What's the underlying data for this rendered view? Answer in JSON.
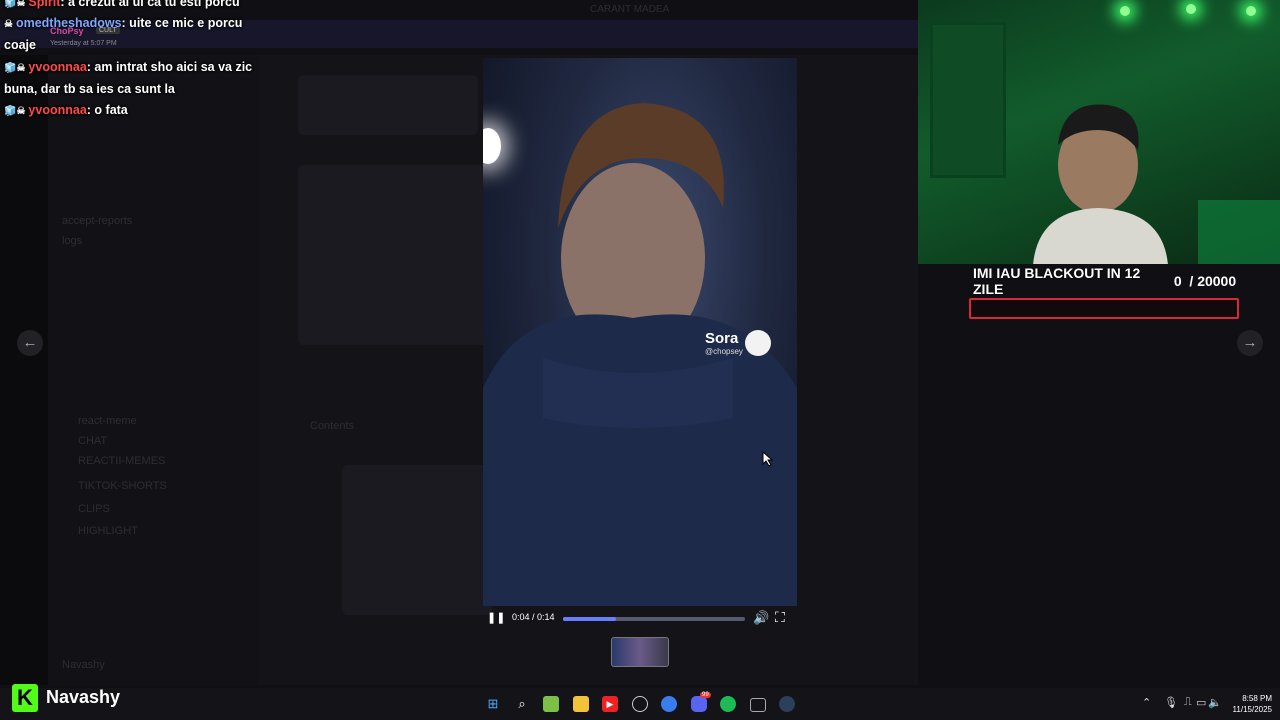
{
  "chat": {
    "messages": [
      {
        "user": "Spirit",
        "text": ": a crezut ai ui ca tu esti porcu"
      },
      {
        "user": "omedtheshadows",
        "text": ": uite ce mic e porcu coaje"
      },
      {
        "user": "yvoonnaa",
        "text": ": am intrat sho aici sa va zic buna, dar tb sa ies ca sunt la"
      },
      {
        "user": "yvoonnaa",
        "text": ": o fata"
      }
    ],
    "embedded_user": "ChoPsy",
    "embedded_badge": "CULT",
    "embedded_time": "Yesterday at 5:07 PM"
  },
  "background": {
    "server_title": "CARANT MADEA",
    "channel_active": "REACTII-MEMES",
    "channels": [
      "accept-reports",
      "logs",
      "react-meme",
      "CHAT",
      "TIKTOK-SHORTS",
      "CLIPS",
      "HIGHLIGHT"
    ],
    "attachment_label": "Contents",
    "user_label": "Navashy"
  },
  "goal": {
    "title": "IMI IAU BLACKOUT IN 12 ZILE",
    "current": "0",
    "target": "/ 20000",
    "progress": 0
  },
  "video": {
    "watermark": "Sora",
    "handle": "@chopsey",
    "time": "0:04 / 0:14",
    "progress_fraction": 0.29,
    "pause_icon": "pause-icon",
    "volume_icon": "volume-icon",
    "fullscreen_icon": "fullscreen-icon"
  },
  "nav": {
    "prev_icon": "arrow-left-icon",
    "next_icon": "arrow-right-icon"
  },
  "brand": {
    "logo": "K",
    "name": "Navashy",
    "color": "#53fc18"
  },
  "taskbar": {
    "icons": [
      "windows-start-icon",
      "search-icon",
      "notepad-icon",
      "file-explorer-icon",
      "youtube-icon",
      "chatgpt-icon",
      "chrome-icon",
      "discord-icon",
      "spotify-icon",
      "app-icon",
      "steam-icon"
    ],
    "discord_badge": "99"
  },
  "clock": {
    "time": "8:58 PM",
    "date": "11/15/2025"
  },
  "colors": {
    "goal_border": "#d8283c",
    "progress_fill": "#6c7cff",
    "cam_green": "#125c2c"
  }
}
